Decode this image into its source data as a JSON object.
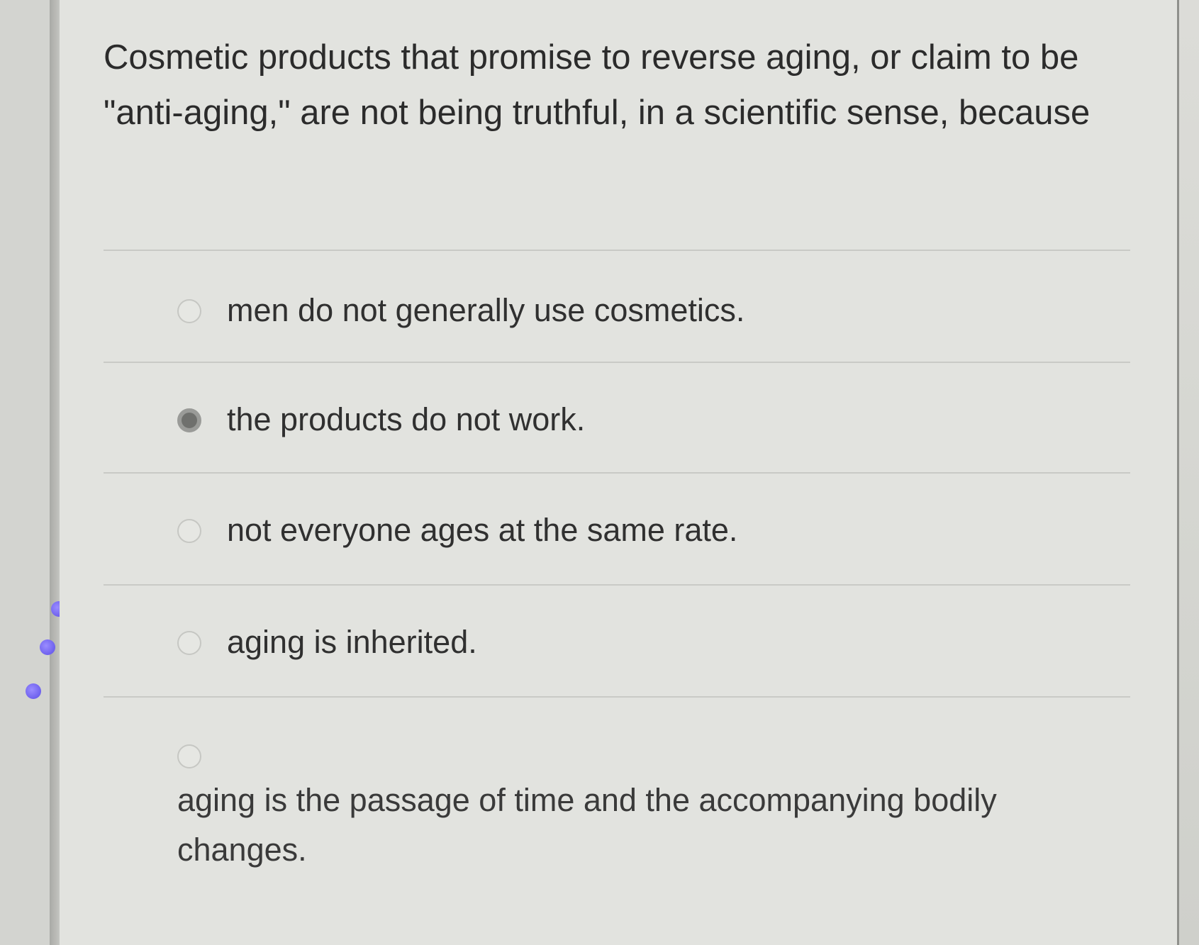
{
  "question": {
    "text": "Cosmetic products that promise to reverse aging, or claim to be \"anti-aging,\" are not being truthful, in a scientific sense, because"
  },
  "options": [
    {
      "label": "men do not generally use cosmetics.",
      "selected": false
    },
    {
      "label": "the products do not work.",
      "selected": true
    },
    {
      "label": "not everyone ages at the same rate.",
      "selected": false
    },
    {
      "label": "aging is inherited.",
      "selected": false
    },
    {
      "label": "aging is the passage of time and the accompanying bodily changes.",
      "selected": false
    }
  ]
}
